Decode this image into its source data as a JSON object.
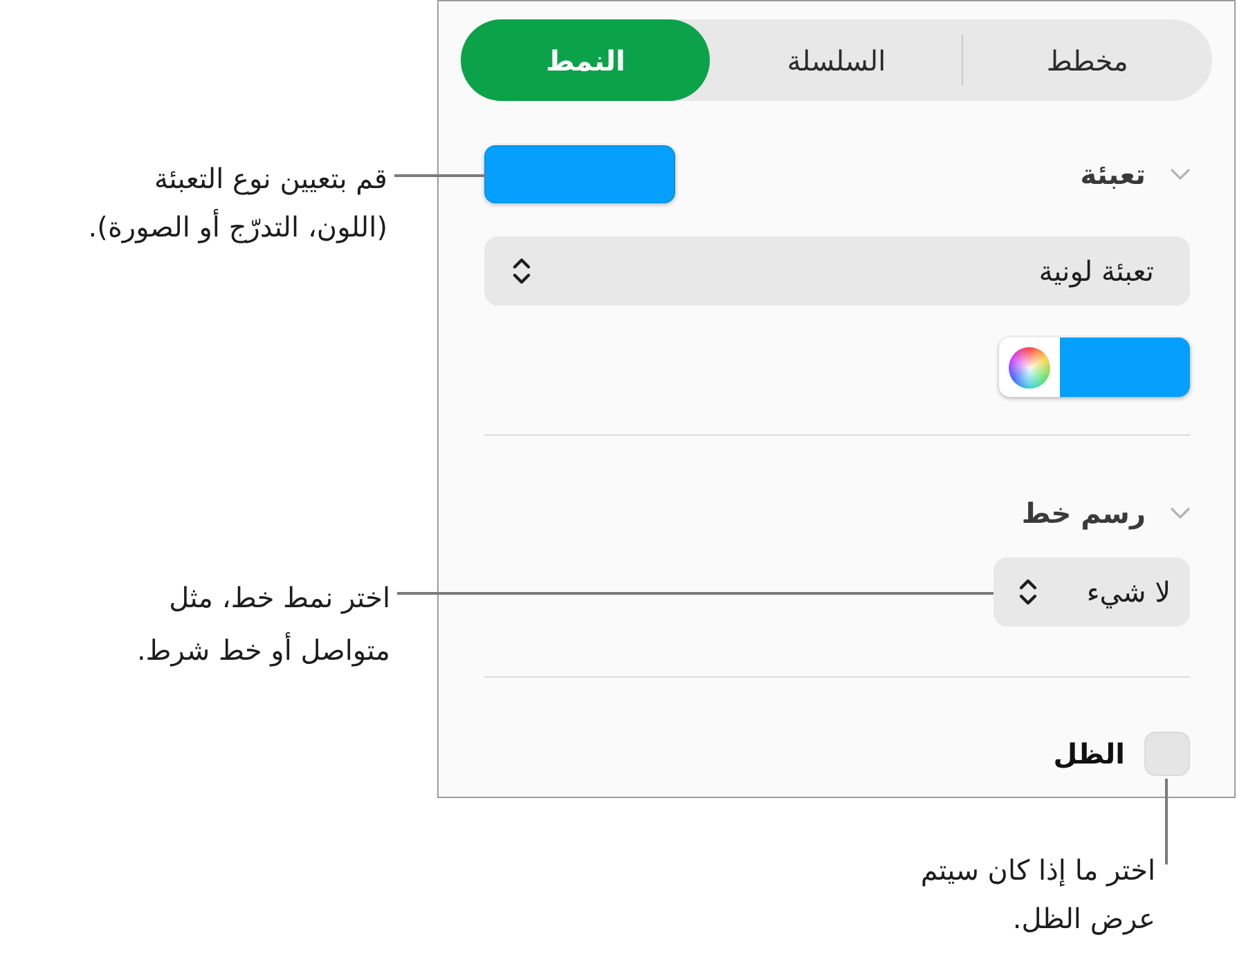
{
  "tabs": [
    {
      "label": "مخطط",
      "selected": false
    },
    {
      "label": "السلسلة",
      "selected": false
    },
    {
      "label": "النمط",
      "selected": true
    }
  ],
  "fill": {
    "title": "تعبئة",
    "expanded": true,
    "fill_type": "تعبئة لونية",
    "callout": "قم بتعيين نوع التعبئة (اللون، التدرّج أو الصورة)."
  },
  "stroke": {
    "title": "رسم خط",
    "expanded": true,
    "line_style": "لا شيء",
    "callout": "اختر نمط خط، مثل متواصل أو خط شرط."
  },
  "shadow": {
    "label": "الظل",
    "checked": false,
    "callout": "اختر ما إذا كان سيتم عرض الظل."
  }
}
